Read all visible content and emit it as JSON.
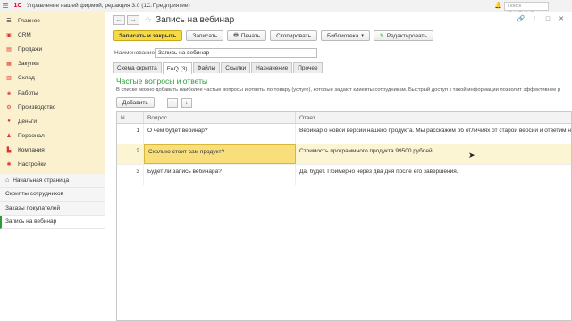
{
  "titlebar": {
    "title": "Управление нашей фирмой, редакция 3.0  (1С:Предприятие)",
    "search_placeholder": "Поиск Ctrl+Shift+F"
  },
  "sidebar": {
    "nav": [
      {
        "label": "Главное",
        "icon": "menu-icon"
      },
      {
        "label": "CRM",
        "icon": "crm-icon"
      },
      {
        "label": "Продажи",
        "icon": "sales-icon"
      },
      {
        "label": "Закупки",
        "icon": "purchases-icon"
      },
      {
        "label": "Склад",
        "icon": "warehouse-icon"
      },
      {
        "label": "Работы",
        "icon": "works-icon"
      },
      {
        "label": "Производство",
        "icon": "production-icon"
      },
      {
        "label": "Деньги",
        "icon": "money-icon"
      },
      {
        "label": "Персонал",
        "icon": "staff-icon"
      },
      {
        "label": "Компания",
        "icon": "company-icon"
      },
      {
        "label": "Настройки",
        "icon": "settings-icon"
      }
    ],
    "open_windows": [
      {
        "label": "Начальная страница"
      },
      {
        "label": "Скрипты сотрудников"
      },
      {
        "label": "Заказы покупателей"
      },
      {
        "label": "Запись на вебинар"
      }
    ]
  },
  "document": {
    "title": "Запись на вебинар"
  },
  "toolbar": {
    "save_close": "Записать и закрыть",
    "save": "Записать",
    "print": "Печать",
    "copy": "Скопировать",
    "library": "Библиотека",
    "edit": "Редактировать"
  },
  "form": {
    "name_label": "Наименование:",
    "name_value": "Запись на вебинар"
  },
  "tabs": [
    "Схема скрипта",
    "FAQ (3)",
    "Файлы",
    "Ссылки",
    "Назначение",
    "Прочее"
  ],
  "faq": {
    "title": "Частые вопросы и ответы",
    "description": "В списке можно добавить наиболее частые вопросы и ответы по товару (услуге), которые задают клиенты сотрудникам. Быстрый доступ к такой информации позволит эффективнее р",
    "add_label": "Добавить",
    "columns": {
      "n": "N",
      "question": "Вопрос",
      "answer": "Ответ"
    },
    "rows": [
      {
        "n": "1",
        "question": "О чем будет вебинар?",
        "answer": "Вебинар о новой версии нашего продукта. Мы расскажем об отличиях от старой версии и ответим на вопрос"
      },
      {
        "n": "2",
        "question": "Сколько стоит сам продукт?",
        "answer": "Стоимость программного продукта 99500 рублей."
      },
      {
        "n": "3",
        "question": "Будет ли запись вебинара?",
        "answer": "Да, будет. Примерно через два дня после его завершения."
      }
    ]
  }
}
